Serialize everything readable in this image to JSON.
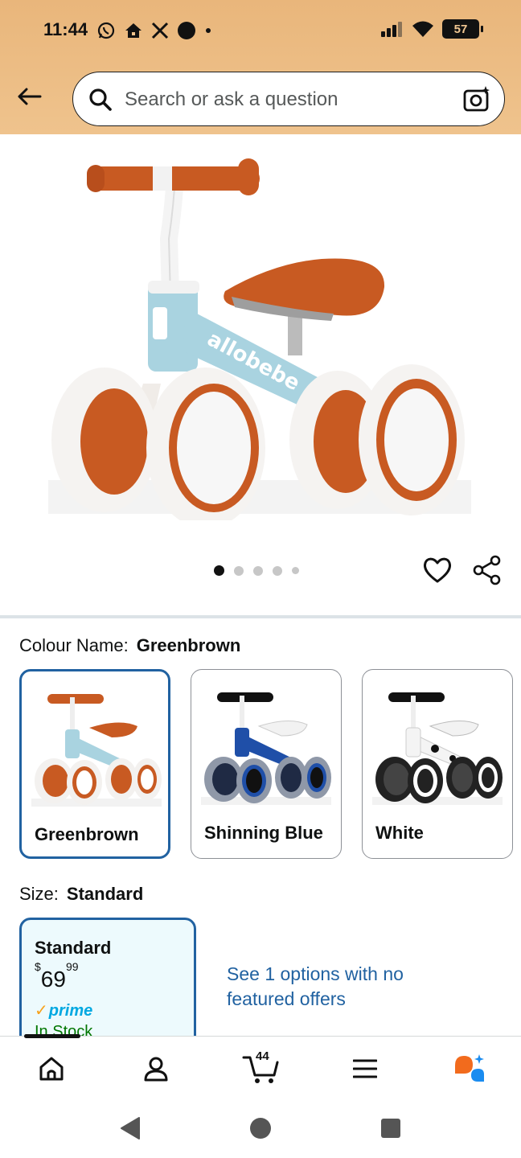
{
  "status_bar": {
    "time": "11:44",
    "battery": "57",
    "left_icons": [
      "whatsapp-icon",
      "home-app-icon",
      "x-icon",
      "record-dot-icon",
      "small-dot-icon"
    ],
    "right_icons": [
      "signal-icon",
      "wifi-icon",
      "battery-icon"
    ]
  },
  "search": {
    "placeholder": "Search or ask a question",
    "back_icon": "arrow-left-icon",
    "search_icon": "search-icon",
    "camera_icon": "camera-icon"
  },
  "product_image": {
    "description_icon": "balance-bike-image",
    "brand_on_frame": "allobebe",
    "dots_count": 5,
    "active_dot": 0,
    "wishlist_icon": "heart-icon",
    "share_icon": "share-icon"
  },
  "colour": {
    "label": "Colour Name:",
    "selected": "Greenbrown",
    "options": [
      {
        "name": "Greenbrown",
        "selected": true
      },
      {
        "name": "Shinning Blue",
        "selected": false
      },
      {
        "name": "White",
        "selected": false
      }
    ]
  },
  "size": {
    "label": "Size:",
    "selected": "Standard",
    "card": {
      "name": "Standard",
      "currency": "$",
      "price_whole": "69",
      "price_fraction": "99",
      "prime": "prime",
      "stock": "In Stock"
    },
    "other_offers": "See 1 options with no featured offers"
  },
  "bottom_nav": {
    "items": [
      "home-icon",
      "account-icon",
      "cart-icon",
      "menu-icon",
      "rufus-icon"
    ],
    "cart_count": "44"
  },
  "colors": {
    "header_bg": "#efc38d",
    "link_blue": "#2162a1",
    "selected_border": "#2162a1",
    "in_stock_green": "#007600",
    "prime_blue": "#00a8e1",
    "bike_orange": "#c85a22",
    "bike_blue": "#a9d3e0"
  }
}
